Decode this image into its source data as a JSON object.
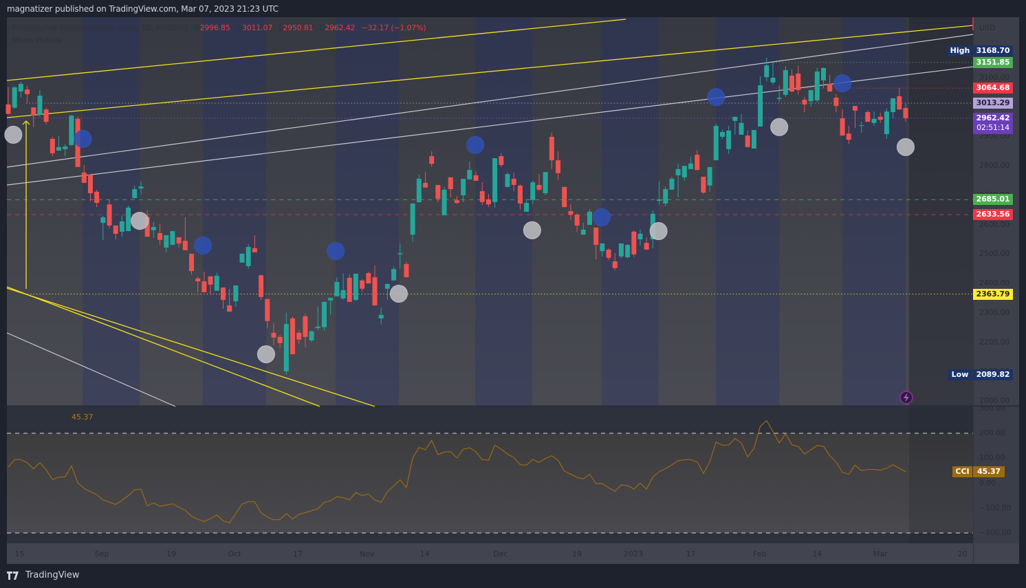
{
  "header": {
    "publisher_line": "magnatizer published on TradingView.com, Mar 07, 2023 21:23 UTC"
  },
  "legend": {
    "symbol_title": "Philadelphia Semiconductor Index, 1D, NASDAQ",
    "o_label": "O",
    "o": "2996.85",
    "h_label": "H",
    "h": "3011.07",
    "l_label": "L",
    "l": "2950.81",
    "c_label": "C",
    "c": "2962.42",
    "change": "−32.17 (−1.07%)",
    "indicator": "Moon Phases"
  },
  "price_axis": {
    "currency": "USD",
    "ticks": [
      "3100.00",
      "3000.00",
      "2900.00",
      "2800.00",
      "2700.00",
      "2600.00",
      "2500.00",
      "2400.00",
      "2300.00",
      "2200.00",
      "2100.00",
      "2000.00"
    ]
  },
  "price_labels": {
    "high": {
      "label": "High",
      "value": "3168.70",
      "color": "#1c3468"
    },
    "low": {
      "label": "Low",
      "value": "2089.82",
      "color": "#1c3468"
    },
    "current": {
      "value": "2962.42",
      "countdown": "02:51:14",
      "color": "#6a3fb8"
    },
    "levels": [
      {
        "value": "3151.85",
        "color": "#4caf50",
        "text_color": "#ffffff",
        "style": "dotted",
        "from_bar": 121
      },
      {
        "value": "3064.68",
        "color": "#f23645",
        "text_color": "#ffffff",
        "style": "dotted",
        "from_bar": 121
      },
      {
        "value": "3013.29",
        "color": "#b7a3dc",
        "text_color": "#1e222d",
        "style": "dotted",
        "from_bar": 2.8
      },
      {
        "value": "2685.01",
        "color": "#4caf50",
        "text_color": "#ffffff",
        "style": "dashed",
        "from_bar": -0.2
      },
      {
        "value": "2633.56",
        "color": "#f23645",
        "text_color": "#ffffff",
        "style": "dashed",
        "from_bar": -0.2
      },
      {
        "value": "2363.79",
        "color": "#ffeb3b",
        "text_color": "#1e222d",
        "style": "dotted",
        "from_bar": 3
      }
    ]
  },
  "cci": {
    "title": "CCI (55, close)",
    "value": "45.37",
    "badge_label": "CCI",
    "color": "#9c6a12",
    "ticks": [
      {
        "text": "300.00",
        "v": 300
      },
      {
        "text": "200.00",
        "v": 200
      },
      {
        "text": "100.00",
        "v": 100
      },
      {
        "text": "0.00",
        "v": 0
      },
      {
        "text": "−100.00",
        "v": -100
      },
      {
        "text": "−200.00",
        "v": -200
      }
    ]
  },
  "time_axis": {
    "labels": [
      {
        "text": "15",
        "bar": 1.8
      },
      {
        "text": "Sep",
        "bar": 14.8
      },
      {
        "text": "19",
        "bar": 25.8
      },
      {
        "text": "Oct",
        "bar": 35.8
      },
      {
        "text": "17",
        "bar": 45.8
      },
      {
        "text": "Nov",
        "bar": 56.8
      },
      {
        "text": "14",
        "bar": 65.9
      },
      {
        "text": "Dec",
        "bar": 77.9
      },
      {
        "text": "19",
        "bar": 90
      },
      {
        "text": "2023",
        "bar": 98.9
      },
      {
        "text": "17",
        "bar": 108
      },
      {
        "text": "Feb",
        "bar": 118.9
      },
      {
        "text": "14",
        "bar": 128
      },
      {
        "text": "Mar",
        "bar": 138
      },
      {
        "text": "20",
        "bar": 151
      }
    ]
  },
  "footer": {
    "brand": "TradingView"
  },
  "colors": {
    "up": "#26a69a",
    "down": "#ef5350",
    "new_moon": "#2f4fb4",
    "full_moon": "#b9babe"
  },
  "chart_data": {
    "type": "candlestick",
    "title": "Philadelphia Semiconductor Index, 1D, NASDAQ",
    "ylim": [
      2000,
      3100
    ],
    "ohlc": [
      [
        3009,
        3068,
        2975,
        2977
      ],
      [
        2998,
        3072,
        2995,
        3067
      ],
      [
        3053,
        3086,
        3032,
        3079
      ],
      [
        3060,
        3072,
        3015,
        3044
      ],
      [
        2999,
        2999,
        2932,
        2971
      ],
      [
        2974,
        3058,
        2967,
        3039
      ],
      [
        2992,
        2998,
        2941,
        2950
      ],
      [
        2892,
        2898,
        2833,
        2843
      ],
      [
        2852,
        2901,
        2852,
        2864
      ],
      [
        2857,
        2873,
        2833,
        2866
      ],
      [
        2871,
        2973,
        2869,
        2971
      ],
      [
        2960,
        2967,
        2796,
        2796
      ],
      [
        2777,
        2803,
        2742,
        2742
      ],
      [
        2770,
        2770,
        2679,
        2707
      ],
      [
        2712,
        2719,
        2660,
        2674
      ],
      [
        2606,
        2630,
        2548,
        2625
      ],
      [
        2669,
        2686,
        2588,
        2597
      ],
      [
        2597,
        2597,
        2550,
        2569
      ],
      [
        2576,
        2632,
        2559,
        2611
      ],
      [
        2578,
        2665,
        2578,
        2658
      ],
      [
        2690,
        2733,
        2690,
        2721
      ],
      [
        2723,
        2747,
        2702,
        2730
      ],
      [
        2627,
        2648,
        2559,
        2559
      ],
      [
        2581,
        2609,
        2555,
        2592
      ],
      [
        2571,
        2602,
        2531,
        2548
      ],
      [
        2522,
        2564,
        2506,
        2564
      ],
      [
        2531,
        2578,
        2531,
        2578
      ],
      [
        2557,
        2557,
        2522,
        2536
      ],
      [
        2545,
        2625,
        2513,
        2513
      ],
      [
        2501,
        2501,
        2430,
        2442
      ],
      [
        2417,
        2424,
        2370,
        2407
      ],
      [
        2407,
        2440,
        2370,
        2370
      ],
      [
        2424,
        2424,
        2361,
        2396
      ],
      [
        2375,
        2436,
        2375,
        2426
      ],
      [
        2386,
        2386,
        2314,
        2344
      ],
      [
        2325,
        2381,
        2304,
        2304
      ],
      [
        2339,
        2393,
        2321,
        2393
      ],
      [
        2471,
        2503,
        2471,
        2501
      ],
      [
        2459,
        2533,
        2450,
        2524
      ],
      [
        2520,
        2564,
        2506,
        2506
      ],
      [
        2428,
        2428,
        2344,
        2354
      ],
      [
        2347,
        2347,
        2248,
        2272
      ],
      [
        2232,
        2265,
        2190,
        2216
      ],
      [
        2218,
        2225,
        2180,
        2197
      ],
      [
        2101,
        2300,
        2090,
        2262
      ],
      [
        2281,
        2286,
        2159,
        2159
      ],
      [
        2232,
        2241,
        2195,
        2209
      ],
      [
        2288,
        2297,
        2183,
        2218
      ],
      [
        2206,
        2240,
        2200,
        2237
      ],
      [
        2248,
        2321,
        2241,
        2253
      ],
      [
        2251,
        2339,
        2239,
        2337
      ],
      [
        2342,
        2351,
        2293,
        2351
      ],
      [
        2356,
        2421,
        2356,
        2405
      ],
      [
        2349,
        2433,
        2344,
        2377
      ],
      [
        2419,
        2431,
        2337,
        2337
      ],
      [
        2344,
        2433,
        2340,
        2433
      ],
      [
        2410,
        2415,
        2372,
        2382
      ],
      [
        2435,
        2440,
        2400,
        2400
      ],
      [
        2421,
        2461,
        2325,
        2325
      ],
      [
        2281,
        2318,
        2260,
        2293
      ],
      [
        2382,
        2400,
        2344,
        2398
      ],
      [
        2410,
        2456,
        2410,
        2449
      ],
      [
        2499,
        2536,
        2452,
        2503
      ],
      [
        2466,
        2473,
        2421,
        2421
      ],
      [
        2566,
        2672,
        2541,
        2672
      ],
      [
        2676,
        2770,
        2676,
        2756
      ],
      [
        2742,
        2779,
        2726,
        2726
      ],
      [
        2833,
        2850,
        2798,
        2807
      ],
      [
        2735,
        2735,
        2676,
        2688
      ],
      [
        2632,
        2728,
        2632,
        2719
      ],
      [
        2761,
        2761,
        2693,
        2721
      ],
      [
        2683,
        2697,
        2670,
        2674
      ],
      [
        2700,
        2756,
        2676,
        2756
      ],
      [
        2754,
        2815,
        2754,
        2786
      ],
      [
        2768,
        2782,
        2749,
        2749
      ],
      [
        2714,
        2744,
        2667,
        2677
      ],
      [
        2686,
        2704,
        2660,
        2669
      ],
      [
        2677,
        2826,
        2658,
        2826
      ],
      [
        2833,
        2843,
        2796,
        2803
      ],
      [
        2728,
        2777,
        2728,
        2772
      ],
      [
        2756,
        2777,
        2714,
        2735
      ],
      [
        2733,
        2737,
        2651,
        2672
      ],
      [
        2644,
        2688,
        2644,
        2674
      ],
      [
        2684,
        2749,
        2670,
        2744
      ],
      [
        2735,
        2772,
        2716,
        2719
      ],
      [
        2707,
        2779,
        2700,
        2779
      ],
      [
        2899,
        2913,
        2789,
        2819
      ],
      [
        2819,
        2850,
        2752,
        2775
      ],
      [
        2728,
        2730,
        2658,
        2660
      ],
      [
        2646,
        2669,
        2616,
        2634
      ],
      [
        2634,
        2639,
        2576,
        2597
      ],
      [
        2566,
        2606,
        2566,
        2583
      ],
      [
        2599,
        2653,
        2599,
        2644
      ],
      [
        2590,
        2590,
        2482,
        2531
      ],
      [
        2510,
        2536,
        2492,
        2536
      ],
      [
        2515,
        2520,
        2480,
        2487
      ],
      [
        2475,
        2503,
        2445,
        2452
      ],
      [
        2492,
        2536,
        2485,
        2536
      ],
      [
        2489,
        2534,
        2485,
        2531
      ],
      [
        2576,
        2580,
        2490,
        2499
      ],
      [
        2550,
        2583,
        2529,
        2569
      ],
      [
        2538,
        2557,
        2515,
        2515
      ],
      [
        2550,
        2648,
        2520,
        2637
      ],
      [
        2681,
        2747,
        2669,
        2686
      ],
      [
        2672,
        2730,
        2662,
        2721
      ],
      [
        2719,
        2763,
        2719,
        2756
      ],
      [
        2768,
        2808,
        2693,
        2789
      ],
      [
        2761,
        2800,
        2749,
        2800
      ],
      [
        2789,
        2831,
        2789,
        2808
      ],
      [
        2838,
        2854,
        2786,
        2786
      ],
      [
        2763,
        2763,
        2704,
        2709
      ],
      [
        2733,
        2796,
        2712,
        2796
      ],
      [
        2819,
        2943,
        2819,
        2936
      ],
      [
        2899,
        2922,
        2892,
        2915
      ],
      [
        2857,
        2936,
        2841,
        2920
      ],
      [
        2953,
        2967,
        2906,
        2967
      ],
      [
        2906,
        2976,
        2906,
        2946
      ],
      [
        2903,
        2920,
        2864,
        2864
      ],
      [
        2859,
        2922,
        2859,
        2922
      ],
      [
        2934,
        3105,
        2934,
        3074
      ],
      [
        3102,
        3168.7,
        3088,
        3142
      ],
      [
        3084,
        3151,
        3077,
        3100
      ],
      [
        3028,
        3074,
        3018,
        3032
      ],
      [
        3042,
        3140,
        3035,
        3126
      ],
      [
        3107,
        3128,
        3051,
        3053
      ],
      [
        3114,
        3142,
        3042,
        3058
      ],
      [
        3025,
        3035,
        2983,
        3009
      ],
      [
        3020,
        3058,
        3002,
        3058
      ],
      [
        3023,
        3133,
        3016,
        3121
      ],
      [
        3091,
        3135,
        3065,
        3133
      ],
      [
        3079,
        3109,
        3053,
        3053
      ],
      [
        3032,
        3044,
        2983,
        3004
      ],
      [
        2962,
        2992,
        2903,
        2903
      ],
      [
        2910,
        2936,
        2875,
        2889
      ],
      [
        3004,
        3004,
        2929,
        2988
      ],
      [
        2936,
        2950,
        2913,
        2938
      ],
      [
        2983,
        2988,
        2950,
        2950
      ],
      [
        2946,
        2985,
        2936,
        2960
      ],
      [
        2967,
        2981,
        2946,
        2957
      ],
      [
        2908,
        2995,
        2892,
        2985
      ],
      [
        2983,
        3030,
        2962,
        3030
      ],
      [
        3037,
        3065,
        2990,
        2992
      ],
      [
        2996.85,
        3011.07,
        2950.81,
        2962.42
      ]
    ],
    "cci": [
      64,
      94,
      94,
      82,
      57,
      82,
      53,
      14,
      24,
      25,
      69,
      2,
      -21,
      -34,
      -46,
      -67,
      -76,
      -86,
      -69,
      -50,
      -27,
      -24,
      -91,
      -79,
      -93,
      -88,
      -83,
      -97,
      -109,
      -133,
      -145,
      -154,
      -142,
      -128,
      -151,
      -160,
      -122,
      -84,
      -74,
      -75,
      -119,
      -136,
      -147,
      -146,
      -122,
      -144,
      -125,
      -118,
      -111,
      -103,
      -77,
      -71,
      -54,
      -59,
      -67,
      -38,
      -50,
      -44,
      -67,
      -77,
      -34,
      -11,
      13,
      -18,
      101,
      143,
      134,
      171,
      114,
      125,
      126,
      101,
      136,
      142,
      126,
      94,
      92,
      152,
      136,
      117,
      102,
      74,
      72,
      95,
      83,
      99,
      110,
      92,
      48,
      36,
      23,
      17,
      36,
      -2,
      -2,
      -18,
      -33,
      -7,
      -10,
      -24,
      0,
      -24,
      25,
      46,
      58,
      73,
      90,
      94,
      94,
      85,
      39,
      85,
      165,
      152,
      153,
      179,
      161,
      105,
      140,
      228,
      251,
      207,
      161,
      198,
      154,
      147,
      117,
      133,
      151,
      148,
      110,
      85,
      43,
      36,
      72,
      50,
      55,
      55,
      52,
      60,
      74,
      60,
      45.37
    ],
    "cci_levels": [
      200,
      -200
    ],
    "cci_ylim": [
      -200,
      300
    ],
    "moon_phases": [
      {
        "phase": "full",
        "bar": 0.8,
        "price": 2906
      },
      {
        "phase": "new",
        "bar": 11.8,
        "price": 2892
      },
      {
        "phase": "full",
        "bar": 20.8,
        "price": 2613
      },
      {
        "phase": "new",
        "bar": 30.8,
        "price": 2529
      },
      {
        "phase": "full",
        "bar": 40.8,
        "price": 2159
      },
      {
        "phase": "new",
        "bar": 51.8,
        "price": 2510
      },
      {
        "phase": "full",
        "bar": 61.8,
        "price": 2365
      },
      {
        "phase": "new",
        "bar": 73.9,
        "price": 2871
      },
      {
        "phase": "full",
        "bar": 82.9,
        "price": 2581
      },
      {
        "phase": "new",
        "bar": 93.9,
        "price": 2625
      },
      {
        "phase": "full",
        "bar": 102.9,
        "price": 2578
      },
      {
        "phase": "new",
        "bar": 112,
        "price": 3034
      },
      {
        "phase": "full",
        "bar": 122,
        "price": 2932
      },
      {
        "phase": "new",
        "bar": 132,
        "price": 3081
      },
      {
        "phase": "full",
        "bar": 142,
        "price": 2864
      }
    ]
  }
}
